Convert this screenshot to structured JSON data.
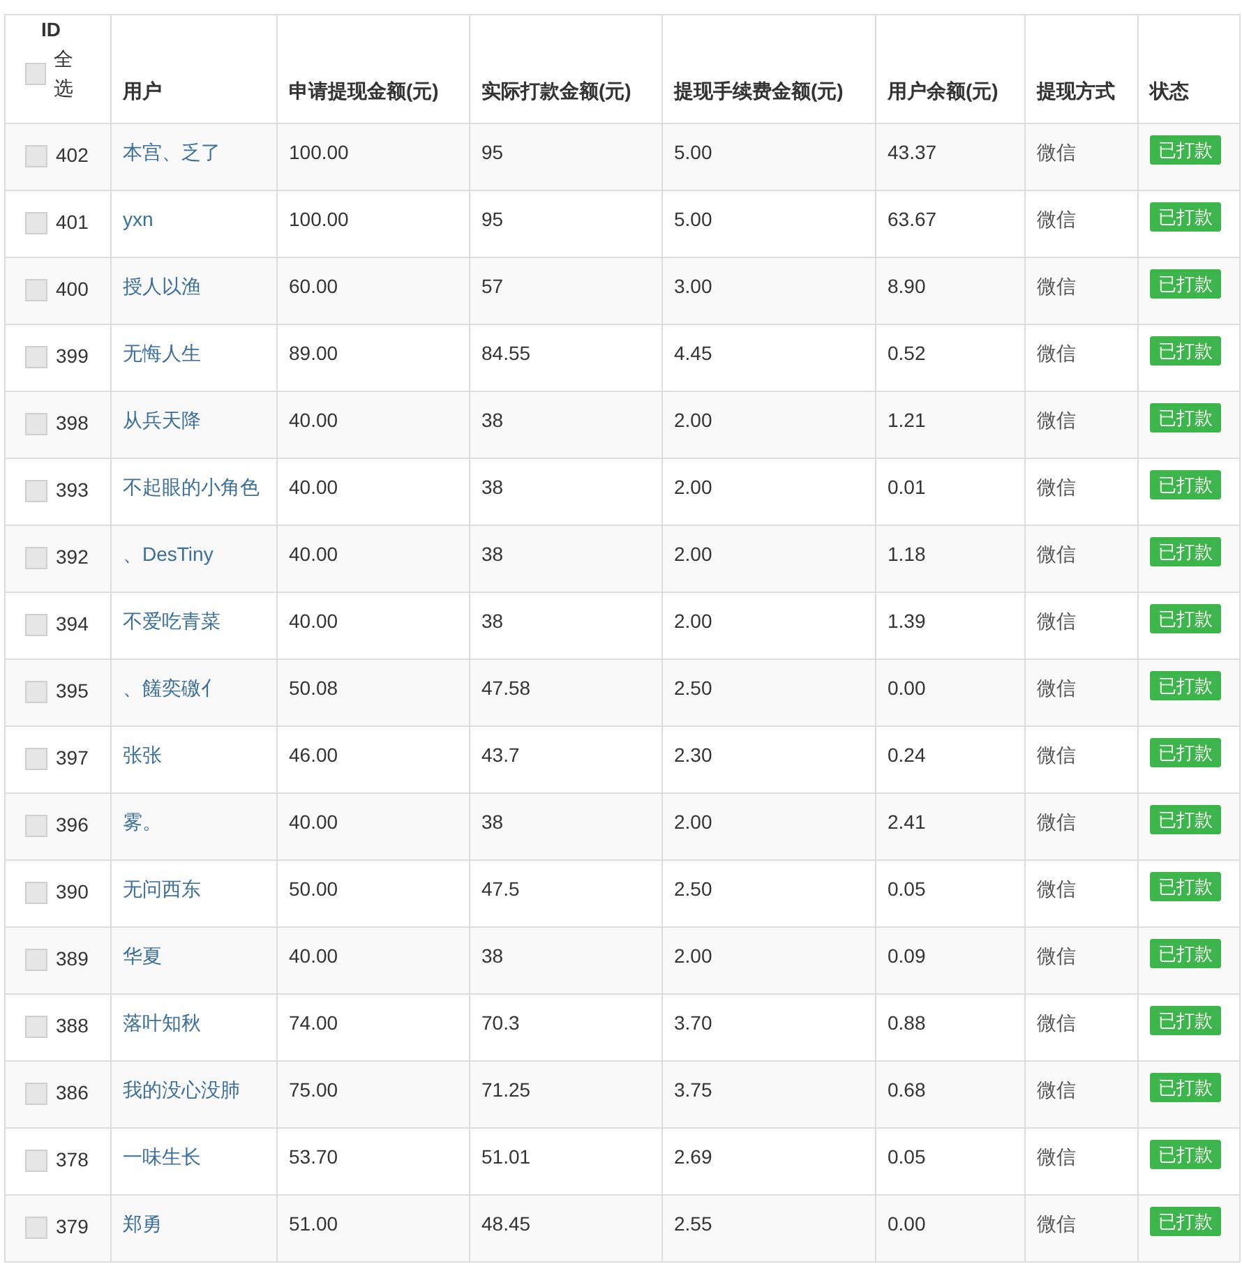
{
  "table": {
    "id_header": {
      "label": "ID",
      "select_all": {
        "label": "全选",
        "checked": false
      }
    },
    "columns": [
      "用户",
      "申请提现金额(元)",
      "实际打款金额(元)",
      "提现手续费金额(元)",
      "用户余额(元)",
      "提现方式",
      "状态"
    ],
    "rows": [
      {
        "id": "402",
        "checked": false,
        "user": "本宫、乏了",
        "requested": "100.00",
        "paid": "95",
        "fee": "5.00",
        "balance": "43.37",
        "method": "微信",
        "status": "已打款"
      },
      {
        "id": "401",
        "checked": false,
        "user": "yxn",
        "requested": "100.00",
        "paid": "95",
        "fee": "5.00",
        "balance": "63.67",
        "method": "微信",
        "status": "已打款"
      },
      {
        "id": "400",
        "checked": false,
        "user": "授人以渔",
        "requested": "60.00",
        "paid": "57",
        "fee": "3.00",
        "balance": "8.90",
        "method": "微信",
        "status": "已打款"
      },
      {
        "id": "399",
        "checked": false,
        "user": "无悔人生",
        "requested": "89.00",
        "paid": "84.55",
        "fee": "4.45",
        "balance": "0.52",
        "method": "微信",
        "status": "已打款"
      },
      {
        "id": "398",
        "checked": false,
        "user": "从兵天降",
        "requested": "40.00",
        "paid": "38",
        "fee": "2.00",
        "balance": "1.21",
        "method": "微信",
        "status": "已打款"
      },
      {
        "id": "393",
        "checked": false,
        "user": "不起眼的小角色",
        "requested": "40.00",
        "paid": "38",
        "fee": "2.00",
        "balance": "0.01",
        "method": "微信",
        "status": "已打款"
      },
      {
        "id": "392",
        "checked": false,
        "user": "、DesTiny",
        "requested": "40.00",
        "paid": "38",
        "fee": "2.00",
        "balance": "1.18",
        "method": "微信",
        "status": "已打款"
      },
      {
        "id": "394",
        "checked": false,
        "user": "不爱吃青菜",
        "requested": "40.00",
        "paid": "38",
        "fee": "2.00",
        "balance": "1.39",
        "method": "微信",
        "status": "已打款"
      },
      {
        "id": "395",
        "checked": false,
        "user": "、饈奕礉亻",
        "requested": "50.08",
        "paid": "47.58",
        "fee": "2.50",
        "balance": "0.00",
        "method": "微信",
        "status": "已打款"
      },
      {
        "id": "397",
        "checked": false,
        "user": "张张",
        "requested": "46.00",
        "paid": "43.7",
        "fee": "2.30",
        "balance": "0.24",
        "method": "微信",
        "status": "已打款"
      },
      {
        "id": "396",
        "checked": false,
        "user": "雾。",
        "requested": "40.00",
        "paid": "38",
        "fee": "2.00",
        "balance": "2.41",
        "method": "微信",
        "status": "已打款"
      },
      {
        "id": "390",
        "checked": false,
        "user": "无问西东",
        "requested": "50.00",
        "paid": "47.5",
        "fee": "2.50",
        "balance": "0.05",
        "method": "微信",
        "status": "已打款"
      },
      {
        "id": "389",
        "checked": false,
        "user": "华夏",
        "requested": "40.00",
        "paid": "38",
        "fee": "2.00",
        "balance": "0.09",
        "method": "微信",
        "status": "已打款"
      },
      {
        "id": "388",
        "checked": false,
        "user": "落叶知秋",
        "requested": "74.00",
        "paid": "70.3",
        "fee": "3.70",
        "balance": "0.88",
        "method": "微信",
        "status": "已打款"
      },
      {
        "id": "386",
        "checked": false,
        "user": "我的没心没肺",
        "requested": "75.00",
        "paid": "71.25",
        "fee": "3.75",
        "balance": "0.68",
        "method": "微信",
        "status": "已打款"
      },
      {
        "id": "378",
        "checked": false,
        "user": "一味生长",
        "requested": "53.70",
        "paid": "51.01",
        "fee": "2.69",
        "balance": "0.05",
        "method": "微信",
        "status": "已打款"
      },
      {
        "id": "379",
        "checked": false,
        "user": "郑勇",
        "requested": "51.00",
        "paid": "48.45",
        "fee": "2.55",
        "balance": "0.00",
        "method": "微信",
        "status": "已打款"
      }
    ]
  }
}
